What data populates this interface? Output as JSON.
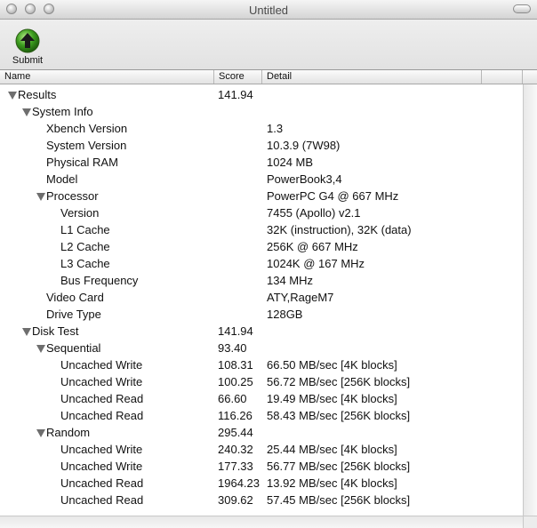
{
  "window": {
    "title": "Untitled"
  },
  "toolbar": {
    "submit_label": "Submit",
    "submit_icon": "green-up-arrow-icon"
  },
  "columns": {
    "name": "Name",
    "score": "Score",
    "detail": "Detail"
  },
  "rows": [
    {
      "name": "Results",
      "score": "141.94",
      "detail": "",
      "level": 0,
      "expanded": true
    },
    {
      "name": "System Info",
      "score": "",
      "detail": "",
      "level": 1,
      "expanded": true
    },
    {
      "name": "Xbench Version",
      "score": "",
      "detail": "1.3",
      "level": 2
    },
    {
      "name": "System Version",
      "score": "",
      "detail": "10.3.9 (7W98)",
      "level": 2
    },
    {
      "name": "Physical RAM",
      "score": "",
      "detail": "1024 MB",
      "level": 2
    },
    {
      "name": "Model",
      "score": "",
      "detail": "PowerBook3,4",
      "level": 2
    },
    {
      "name": "Processor",
      "score": "",
      "detail": "PowerPC G4 @ 667 MHz",
      "level": 2,
      "expanded": true
    },
    {
      "name": "Version",
      "score": "",
      "detail": "7455 (Apollo) v2.1",
      "level": 3
    },
    {
      "name": "L1 Cache",
      "score": "",
      "detail": "32K (instruction), 32K (data)",
      "level": 3
    },
    {
      "name": "L2 Cache",
      "score": "",
      "detail": "256K @ 667 MHz",
      "level": 3
    },
    {
      "name": "L3 Cache",
      "score": "",
      "detail": "1024K @ 167 MHz",
      "level": 3
    },
    {
      "name": "Bus Frequency",
      "score": "",
      "detail": "134 MHz",
      "level": 3
    },
    {
      "name": "Video Card",
      "score": "",
      "detail": "ATY,RageM7",
      "level": 2
    },
    {
      "name": "Drive Type",
      "score": "",
      "detail": "128GB",
      "level": 2
    },
    {
      "name": "Disk Test",
      "score": "141.94",
      "detail": "",
      "level": 1,
      "expanded": true
    },
    {
      "name": "Sequential",
      "score": "93.40",
      "detail": "",
      "level": 2,
      "expanded": true
    },
    {
      "name": "Uncached Write",
      "score": "108.31",
      "detail": "66.50 MB/sec [4K blocks]",
      "level": 3
    },
    {
      "name": "Uncached Write",
      "score": "100.25",
      "detail": "56.72 MB/sec [256K blocks]",
      "level": 3
    },
    {
      "name": "Uncached Read",
      "score": "66.60",
      "detail": "19.49 MB/sec [4K blocks]",
      "level": 3
    },
    {
      "name": "Uncached Read",
      "score": "116.26",
      "detail": "58.43 MB/sec [256K blocks]",
      "level": 3
    },
    {
      "name": "Random",
      "score": "295.44",
      "detail": "",
      "level": 2,
      "expanded": true
    },
    {
      "name": "Uncached Write",
      "score": "240.32",
      "detail": "25.44 MB/sec [4K blocks]",
      "level": 3
    },
    {
      "name": "Uncached Write",
      "score": "177.33",
      "detail": "56.77 MB/sec [256K blocks]",
      "level": 3
    },
    {
      "name": "Uncached Read",
      "score": "1964.23",
      "detail": "13.92 MB/sec [4K blocks]",
      "level": 3
    },
    {
      "name": "Uncached Read",
      "score": "309.62",
      "detail": "57.45 MB/sec [256K blocks]",
      "level": 3
    }
  ]
}
